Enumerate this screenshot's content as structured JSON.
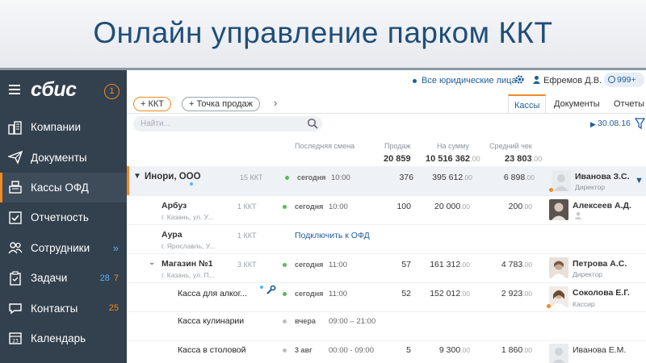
{
  "banner": {
    "title": "Онлайн управление парком ККТ"
  },
  "sidebar": {
    "logo": "сбис",
    "notifications": "1",
    "items": [
      {
        "label": "Компании",
        "icon": "buildings-icon"
      },
      {
        "label": "Документы",
        "icon": "paper-plane-icon"
      },
      {
        "label": "Кассы ОФД",
        "icon": "cash-register-icon"
      },
      {
        "label": "Отчетность",
        "icon": "checkbox-icon"
      },
      {
        "label": "Сотрудники",
        "icon": "people-icon",
        "chevron": "»"
      },
      {
        "label": "Задачи",
        "icon": "clipboard-icon",
        "count_blue": "28",
        "count_orange": "7"
      },
      {
        "label": "Контакты",
        "icon": "chat-icon",
        "count_orange": "25"
      },
      {
        "label": "Календарь",
        "icon": "calendar-icon"
      }
    ]
  },
  "topbar": {
    "org": "Все юридические лица",
    "user": "Ефремов Д.В.",
    "badge": "999+"
  },
  "toolbar": {
    "add_kkt": "+ ККТ",
    "add_pos": "+ Точка продаж",
    "arrow": "›"
  },
  "tabs": [
    "Кассы",
    "Документы",
    "Отчеты"
  ],
  "search": {
    "placeholder": "Найти..."
  },
  "date": "30.08.16",
  "columns": {
    "last_shift": "Последняя смена",
    "sales": "Продаж",
    "sum": "На сумму",
    "avg": "Средний чек"
  },
  "totals": {
    "sales": "20 859",
    "sum": "10 516 362",
    "sum_dec": ".00",
    "avg": "23 803",
    "avg_dec": ".00"
  },
  "rows": {
    "inori": {
      "name": "Инори, ООО",
      "kkt": "15 ККТ",
      "day": "сегодня",
      "time": "10:00",
      "sales": "376",
      "sum": "395 612",
      "sum_dec": ".00",
      "avg": "6 898",
      "avg_dec": ".00",
      "person": "Иванова З.С.",
      "role": "Директор"
    },
    "arbuz": {
      "name": "Арбуз",
      "addr": "г. Казань, ул. У...",
      "kkt": "1 ККТ",
      "day": "сегодня",
      "time": "10:00",
      "sales": "100",
      "sum": "20 000",
      "sum_dec": ".00",
      "avg": "200",
      "avg_dec": ".00",
      "person": "Алексеев А.Д."
    },
    "aura": {
      "name": "Аура",
      "addr": "г. Ярославль, У...",
      "kkt": "1 ККТ",
      "link": "Подключить к ОФД"
    },
    "magazin": {
      "name": "Магазин №1",
      "addr": "г. Казань, ул. П...",
      "kkt": "3 ККТ",
      "day": "сегодня",
      "time": "11:00",
      "sales": "57",
      "sum": "161 312",
      "sum_dec": ".00",
      "avg": "4 783",
      "avg_dec": ".00",
      "person": "Петрова А.С.",
      "role": "Директор"
    },
    "kassa1": {
      "name": "Касса для алког...",
      "day": "сегодня",
      "time": "11:00",
      "sales": "52",
      "sum": "152 012",
      "sum_dec": ".00",
      "avg": "2 923",
      "avg_dec": ".00",
      "person": "Соколова Е.Г.",
      "role": "Кассир"
    },
    "kassa2": {
      "name": "Касса кулинарии",
      "day": "вчера",
      "time": "09:00 – 21:00"
    },
    "kassa3": {
      "name": "Касса в столовой",
      "day": "3 авг",
      "time": "00:00 - 09:00",
      "sales": "5",
      "sum": "9 300",
      "sum_dec": ".00",
      "avg": "1 860",
      "avg_dec": ".00",
      "person": "Иванова Е.М."
    }
  },
  "colors": {
    "accent": "#f08a24",
    "brand_blue": "#1f5d99",
    "sidebar": "#33404d",
    "title": "#1f4e79",
    "ok_green": "#5cb85c"
  }
}
